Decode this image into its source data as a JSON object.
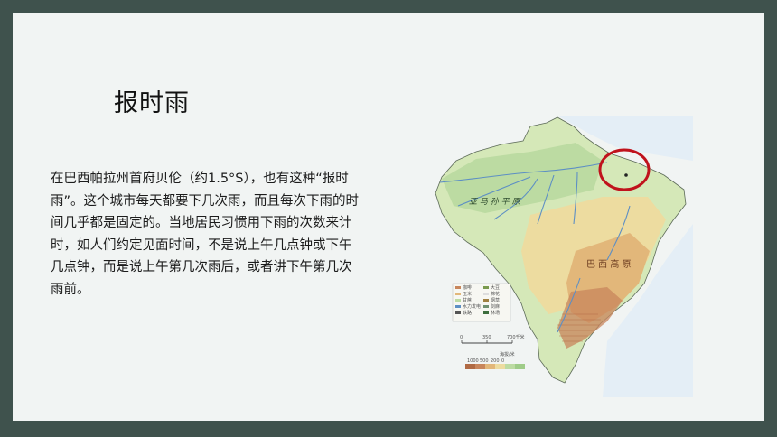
{
  "slide": {
    "title": "报时雨",
    "paragraph": "在巴西帕拉州首府贝伦（约1.5°S），也有这种“报时雨”。这个城市每天都要下几次雨，而且每次下雨的时间几乎都是固定的。当地居民习惯用下雨的次数来计时，如人们约定见面时间，不是说上午几点钟或下午几点钟，而是说上午第几次雨后，或者讲下午第几次雨前。"
  },
  "map": {
    "plain_label": "亚 马 孙 平 原",
    "highland_label": "巴 西 高 原",
    "scale_ticks": [
      "0",
      "350",
      "700千米"
    ],
    "elevation_caption": "海拔/米",
    "elevation_ticks": [
      "1000",
      "500",
      "200",
      "0"
    ],
    "legend": [
      "咖啡",
      "玉米",
      "甘蔗",
      "水力发电",
      "铁路",
      "大豆",
      "棉花",
      "烟草",
      "剑麻",
      "林场"
    ],
    "colors": {
      "ocean": "#e4eef6",
      "lowland": "#bcdba2",
      "plain": "#d5e8b8",
      "upland": "#eddca0",
      "highland": "#e2b77a",
      "mountain": "#c8865c",
      "river": "#5d8fc4",
      "highlight_circle": "#c0121c"
    }
  }
}
